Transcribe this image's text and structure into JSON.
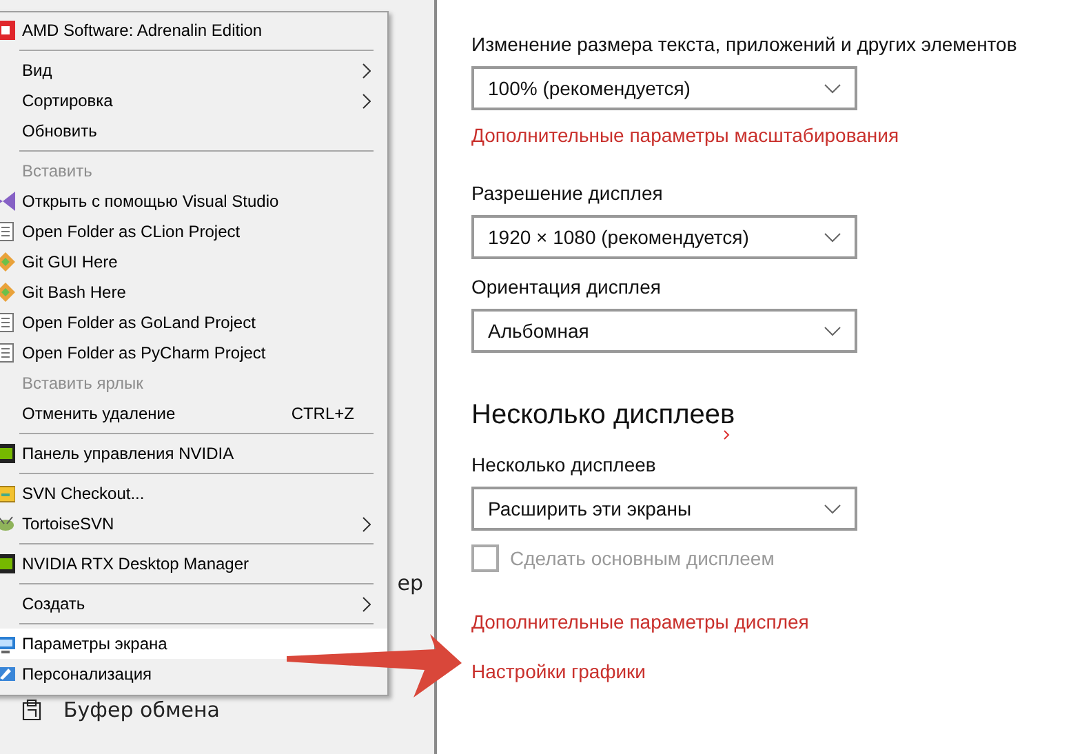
{
  "context_menu": {
    "items": [
      {
        "kind": "item",
        "label": "AMD Software: Adrenalin Edition",
        "submenu": false,
        "disabled": false,
        "selected": false
      },
      {
        "kind": "separator"
      },
      {
        "kind": "item",
        "label": "Вид",
        "submenu": true,
        "disabled": false,
        "selected": false
      },
      {
        "kind": "item",
        "label": "Сортировка",
        "submenu": true,
        "disabled": false,
        "selected": false
      },
      {
        "kind": "item",
        "label": "Обновить",
        "submenu": false,
        "disabled": false,
        "selected": false
      },
      {
        "kind": "separator"
      },
      {
        "kind": "item",
        "label": "Вставить",
        "submenu": false,
        "disabled": true,
        "selected": false
      },
      {
        "kind": "item",
        "label": "Открыть с помощью Visual Studio",
        "submenu": false,
        "disabled": false,
        "selected": false
      },
      {
        "kind": "item",
        "label": "Open Folder as CLion Project",
        "submenu": false,
        "disabled": false,
        "selected": false
      },
      {
        "kind": "item",
        "label": "Git GUI Here",
        "submenu": false,
        "disabled": false,
        "selected": false
      },
      {
        "kind": "item",
        "label": "Git Bash Here",
        "submenu": false,
        "disabled": false,
        "selected": false
      },
      {
        "kind": "item",
        "label": "Open Folder as GoLand Project",
        "submenu": false,
        "disabled": false,
        "selected": false
      },
      {
        "kind": "item",
        "label": "Open Folder as PyCharm Project",
        "submenu": false,
        "disabled": false,
        "selected": false
      },
      {
        "kind": "item",
        "label": "Вставить ярлык",
        "submenu": false,
        "disabled": true,
        "selected": false
      },
      {
        "kind": "item",
        "label": "Отменить удаление",
        "shortcut": "CTRL+Z",
        "submenu": false,
        "disabled": false,
        "selected": false
      },
      {
        "kind": "separator"
      },
      {
        "kind": "item",
        "label": "Панель управления NVIDIA",
        "submenu": false,
        "disabled": false,
        "selected": false
      },
      {
        "kind": "separator"
      },
      {
        "kind": "item",
        "label": "SVN Checkout...",
        "submenu": false,
        "disabled": false,
        "selected": false
      },
      {
        "kind": "item",
        "label": "TortoiseSVN",
        "submenu": true,
        "disabled": false,
        "selected": false
      },
      {
        "kind": "separator"
      },
      {
        "kind": "item",
        "label": "NVIDIA RTX Desktop Manager",
        "submenu": false,
        "disabled": false,
        "selected": false
      },
      {
        "kind": "separator"
      },
      {
        "kind": "item",
        "label": "Создать",
        "submenu": true,
        "disabled": false,
        "selected": false
      },
      {
        "kind": "separator"
      },
      {
        "kind": "item",
        "label": "Параметры экрана",
        "submenu": false,
        "disabled": false,
        "selected": true
      },
      {
        "kind": "item",
        "label": "Персонализация",
        "submenu": false,
        "disabled": false,
        "selected": false
      }
    ]
  },
  "sidebar": {
    "items": [
      {
        "label": "ер"
      },
      {
        "label": "Буфер обмена"
      }
    ]
  },
  "settings": {
    "sections": [
      {
        "kind": "dropdown",
        "label": "Изменение размера текста, приложений и других элементов",
        "value": "100% (рекомендуется)"
      },
      {
        "kind": "link",
        "label": "Дополнительные параметры масштабирования"
      },
      {
        "kind": "dropdown",
        "label": "Разрешение дисплея",
        "value": "1920 × 1080 (рекомендуется)"
      },
      {
        "kind": "dropdown",
        "label": "Ориентация дисплея",
        "value": "Альбомная"
      },
      {
        "kind": "heading",
        "label": "Несколько дисплеев"
      },
      {
        "kind": "dropdown",
        "label": "Несколько дисплеев",
        "value": "Расширить эти экраны"
      },
      {
        "kind": "checkbox",
        "label": "Сделать основным дисплеем",
        "checked": false,
        "disabled": true
      },
      {
        "kind": "link",
        "label": "Дополнительные параметры дисплея"
      },
      {
        "kind": "link",
        "label": "Настройки графики"
      }
    ]
  }
}
